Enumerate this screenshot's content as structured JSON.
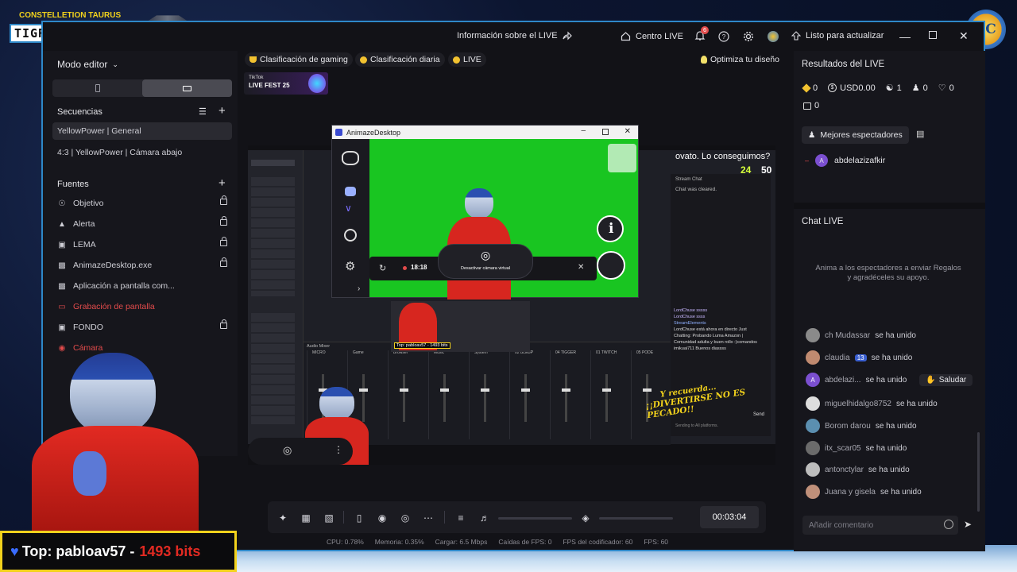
{
  "overlay": {
    "streamer_title": "CONSTELLETION TAURUS",
    "banner": "TIGRESORTEO",
    "logo_text": "LC",
    "top_label": "Top: pabloav57 -",
    "top_bits": "1493 bits"
  },
  "titlebar": {
    "live_info": "Información sobre el LIVE",
    "centro_live": "Centro LIVE",
    "notif_count": "6",
    "ready_update": "Listo para actualizar"
  },
  "left_panel": {
    "mode_editor": "Modo editor",
    "sequences_title": "Secuencias",
    "scenes": [
      "YellowPower | General",
      "4:3 | YellowPower | Cámara abajo"
    ],
    "sources_title": "Fuentes",
    "sources": [
      {
        "label": "Objetivo",
        "icon": "target-icon",
        "locked": true
      },
      {
        "label": "Alerta",
        "icon": "alert-icon",
        "locked": true
      },
      {
        "label": "LEMA",
        "icon": "image-icon",
        "locked": true
      },
      {
        "label": "AnimazeDesktop.exe",
        "icon": "window-icon",
        "locked": true
      },
      {
        "label": "Aplicación a pantalla com...",
        "icon": "window-icon",
        "locked": false
      },
      {
        "label": "Grabación de pantalla",
        "icon": "screen-icon",
        "locked": false,
        "color": "#e24b4b"
      },
      {
        "label": "FONDO",
        "icon": "image-icon",
        "locked": true
      },
      {
        "label": "Cámara",
        "icon": "camera-icon",
        "locked": false,
        "color": "#e24b4b"
      }
    ]
  },
  "top_pills": {
    "gaming_rank": "Clasificación de gaming",
    "daily_rank": "Clasificación diaria",
    "live": "LIVE",
    "optimize": "Optimiza tu diseño"
  },
  "promo": {
    "brand": "TikTok",
    "event": "LIVE FEST 25"
  },
  "preview": {
    "window_title": "AnimazeDesktop",
    "goal_text": "ovato. Lo conseguimos?",
    "goal_current": "24",
    "goal_total": "50",
    "timer": "18:18",
    "cam_button": "Desactivar cámara virtual",
    "chat_header": "Stream Chat",
    "chat_cleared": "Chat was cleared.",
    "chat_lines": [
      "LordChuse sssss",
      "LordChuse ssss",
      "StreamElements",
      "LordChuse está ahora en directo Just Chatting: Probando Luma Amazon | Comunidad adulta y buen rollo :)comandos",
      "imikuai711 Buenos diassss"
    ],
    "overlay_text": "¡¡DIVERTIRSE NO ES PECADO!!",
    "overlay_sub": "Y recuerda...",
    "send": "Send",
    "sending_to": "Sending to All platforms.",
    "mixer_title": "Audio Mixer",
    "mixer_channels": [
      "MICRO",
      "Game",
      "Browser",
      "Music",
      "System",
      "02 BLEBP",
      "04 TIGGER",
      "01 TWITCH",
      "05 PODE"
    ],
    "bottom_chip": "Top: pabloav57 - 1493 bits"
  },
  "controls": {
    "time": "00:03:04"
  },
  "status": {
    "cpu": "CPU: 0.78%",
    "memory": "Memoria: 0.35%",
    "upload": "Cargar: 6.5 Mbps",
    "fps_drops": "Caídas de FPS: 0",
    "encoder_fps": "FPS del codificador: 60",
    "fps": "FPS: 60"
  },
  "right_panel": {
    "results_title": "Resultados del LIVE",
    "stat_diamonds": "0",
    "stat_usd": "USD0.00",
    "stat_viewers": "1",
    "stat_follows": "0",
    "stat_likes": "0",
    "stat_gifts": "0",
    "best_viewers": "Mejores espectadores",
    "top_viewer_name": "abdelazizafkir",
    "top_viewer_initial": "A",
    "chat_title": "Chat LIVE",
    "chat_hint": "Anima a los espectadores a enviar Regalos y agradéceles su apoyo.",
    "joins": [
      {
        "name": "ch Mudassar",
        "suffix": "se ha unido",
        "color": "#8a8a8a"
      },
      {
        "name": "claudia",
        "badge": "13",
        "suffix": "se ha unido",
        "color": "#c08a70"
      },
      {
        "name": "abdelazi...",
        "suffix": "se ha unido",
        "color": "#7b4fd0",
        "initial": "A",
        "action": "Saludar"
      },
      {
        "name": "miguelhidalgo8752",
        "suffix": "se ha unido",
        "color": "#dddddd"
      },
      {
        "name": "Borom darou",
        "suffix": "se ha unido",
        "color": "#5b8fb0"
      },
      {
        "name": "itx_scar05",
        "suffix": "se ha unido",
        "color": "#6b6b6b"
      },
      {
        "name": "antonctylar",
        "suffix": "se ha unido",
        "color": "#bdbdbd"
      },
      {
        "name": "Juana y gisela",
        "suffix": "se ha unido",
        "color": "#c0907a"
      }
    ],
    "comment_placeholder": "Añadir comentario"
  },
  "colors": {
    "accent": "#2e88c8",
    "live_red": "#e24b4b",
    "green_screen": "#19c521",
    "gold": "#f2d21c"
  }
}
